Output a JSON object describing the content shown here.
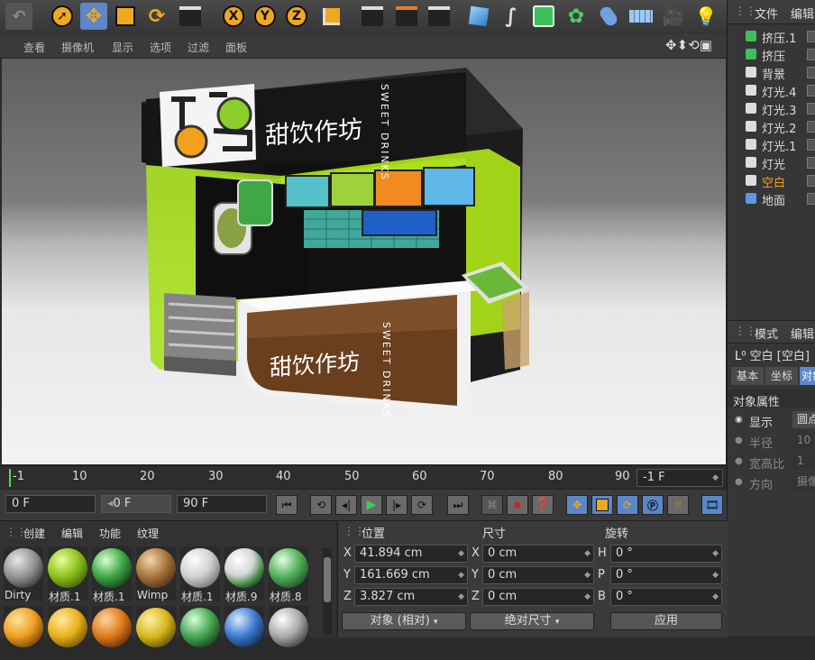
{
  "viewport_menu": [
    "查看",
    "摄像机",
    "显示",
    "选项",
    "过滤",
    "面板"
  ],
  "toolbar": {
    "axis_x": "X",
    "axis_y": "Y",
    "axis_z": "Z"
  },
  "objects_header": {
    "file": "文件",
    "edit": "编辑"
  },
  "objects": [
    {
      "name": "挤压.1",
      "color": "#dcdcdc"
    },
    {
      "name": "挤压",
      "color": "#dcdcdc"
    },
    {
      "name": "背景",
      "color": "#dcdcdc"
    },
    {
      "name": "灯光.4",
      "color": "#dcdcdc"
    },
    {
      "name": "灯光.3",
      "color": "#dcdcdc"
    },
    {
      "name": "灯光.2",
      "color": "#dcdcdc"
    },
    {
      "name": "灯光.1",
      "color": "#dcdcdc"
    },
    {
      "name": "灯光",
      "color": "#dcdcdc"
    },
    {
      "name": "空白",
      "color": "#f2a11e"
    },
    {
      "name": "地面",
      "color": "#dcdcdc"
    }
  ],
  "attributes": {
    "header": {
      "mode": "模式",
      "edit": "编辑"
    },
    "object_title": "空白 [空白]",
    "tabs": [
      "基本",
      "坐标",
      "对象"
    ],
    "section": "对象属性",
    "rows": [
      {
        "label": "显示",
        "value": "圆点"
      },
      {
        "label": "半径",
        "value": "10"
      },
      {
        "label": "宽高比",
        "value": "1"
      },
      {
        "label": "方向",
        "value": "摄像"
      }
    ]
  },
  "timeline": {
    "ticks": [
      "-1",
      "10",
      "20",
      "30",
      "40",
      "50",
      "60",
      "70",
      "80",
      "90"
    ],
    "current_frame": "-1 F"
  },
  "playback": {
    "start": "0 F",
    "preview_start": "0 F",
    "end": "90 F"
  },
  "material_menu": [
    "创建",
    "编辑",
    "功能",
    "纹理"
  ],
  "materials": [
    {
      "name": "Dirty",
      "style": "radial-gradient(circle at 35% 30%,#e8e8e8,#8a8a8a 50%,#3a3a3a 80%)"
    },
    {
      "name": "材质.1",
      "style": "radial-gradient(circle at 35% 30%,#e9ff9a,#8cc21c 45%,#3b5a08 85%)"
    },
    {
      "name": "材质.1",
      "style": "radial-gradient(circle at 35% 30%,#d7ffd7,#3fa845 45%,#0f3a14 85%)"
    },
    {
      "name": "Wimp",
      "style": "radial-gradient(circle at 35% 30%,#f2d7aa,#a8743c 45%,#4a2a10 85%)"
    },
    {
      "name": "材质.1",
      "style": "radial-gradient(circle at 35% 30%,#ffffff,#cfcfcf 45%,#6a6a6a 85%)"
    },
    {
      "name": "材质.9",
      "style": "radial-gradient(circle at 35% 30%,#ffffff,#d6d6d6 40%,#2f7a2f 70%,#222 90%)"
    },
    {
      "name": "材质.8",
      "style": "radial-gradient(circle at 35% 30%,#e0ffe0,#53b05a 45%,#1a4a20 85%)"
    },
    {
      "name": "",
      "style": "radial-gradient(circle at 35% 30%,#ffe2a0,#f0a020 45%,#6a3a06 85%)"
    },
    {
      "name": "",
      "style": "radial-gradient(circle at 35% 30%,#ffe9a0,#e9b21c 45%,#6a4a06 85%)"
    },
    {
      "name": "",
      "style": "radial-gradient(circle at 35% 30%,#ffd7a0,#e07a1c 45%,#5a2806 85%)"
    },
    {
      "name": "",
      "style": "radial-gradient(circle at 35% 30%,#fff0a8,#d8b81c 45%,#5a4806 85%)"
    },
    {
      "name": "",
      "style": "radial-gradient(circle at 35% 30%,#d8ffd8,#46a855 45%,#123c18 85%)"
    },
    {
      "name": "",
      "style": "radial-gradient(circle at 35% 30%,#d8ecff,#3d7ad0 45%,#102848 85%)"
    },
    {
      "name": "",
      "style": "radial-gradient(circle at 35% 30%,#ffffff,#aaaaaa 45%,#333 85%)"
    }
  ],
  "coords": {
    "headers": {
      "position": "位置",
      "size": "尺寸",
      "rotation": "旋转"
    },
    "rows": [
      {
        "axis": "X",
        "pos": "41.894 cm",
        "size_axis": "X",
        "size": "0 cm",
        "rot_axis": "H",
        "rot": "0 °"
      },
      {
        "axis": "Y",
        "pos": "161.669 cm",
        "size_axis": "Y",
        "size": "0 cm",
        "rot_axis": "P",
        "rot": "0 °"
      },
      {
        "axis": "Z",
        "pos": "3.827 cm",
        "size_axis": "Z",
        "size": "0 cm",
        "rot_axis": "B",
        "rot": "0 °"
      }
    ],
    "mode_dropdown": "对象 (相对)",
    "size_dropdown": "绝对尺寸",
    "apply": "应用"
  },
  "scene": {
    "brand_cn": "甜饮作坊",
    "brand_en": "SWEET DRINKS",
    "counter_cn": "甜饮作坊",
    "counter_en": "SWEET DRINKS"
  }
}
